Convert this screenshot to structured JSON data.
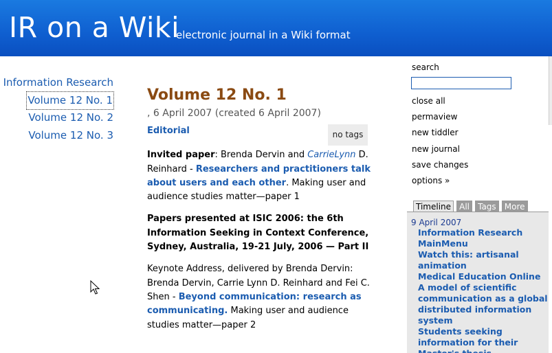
{
  "header": {
    "title": "IR on a Wiki",
    "subtitle": "electronic journal in a Wiki format"
  },
  "mainmenu": {
    "top": "Information Research",
    "items": [
      "Volume 12 No. 1",
      "Volume 12 No. 2",
      "Volume 12 No. 3"
    ]
  },
  "tiddler": {
    "title": "Volume 12 No. 1",
    "subtitle": ", 6 April 2007 (created 6 April 2007)",
    "tags_label": "no tags",
    "editorial": "Editorial",
    "p1": {
      "prefix_bold": "Invited paper",
      "prefix": ": Brenda Dervin and ",
      "link_italic": "CarrieLynn",
      "mid": " D. Reinhard - ",
      "link": "Researchers and practitioners talk about users and each other",
      "suffix": ". Making user and audience studies matter—paper 1"
    },
    "p2_bold": "Papers presented at ISIC 2006: the 6th Information Seeking in Context Conference, Sydney, Australia, 19-21 July, 2006 — Part II",
    "p3": {
      "prefix": "Keynote Address, delivered by Brenda Dervin: Brenda Dervin, Carrie Lynn D. Reinhard and Fei C. Shen - ",
      "link": "Beyond communication: research as communicating.",
      "suffix": " Making user and audience studies matter—paper 2"
    }
  },
  "sidebar": {
    "search_label": "search",
    "items": [
      "close all",
      "permaview",
      "new tiddler",
      "new journal",
      "save changes",
      "options »"
    ]
  },
  "tabs": [
    "Timeline",
    "All",
    "Tags",
    "More"
  ],
  "timeline": {
    "date": "9 April 2007",
    "items": [
      "Information Research",
      "MainMenu",
      "Watch this: artisanal animation",
      "Medical Education Online",
      "A model of scientific communication as a global distributed information system",
      "Students seeking information for their Master's thesis"
    ]
  },
  "colors": {
    "header_blue": "#0f5fd0",
    "link_blue": "#1b5cb0",
    "title_brown": "#8a4a12"
  }
}
